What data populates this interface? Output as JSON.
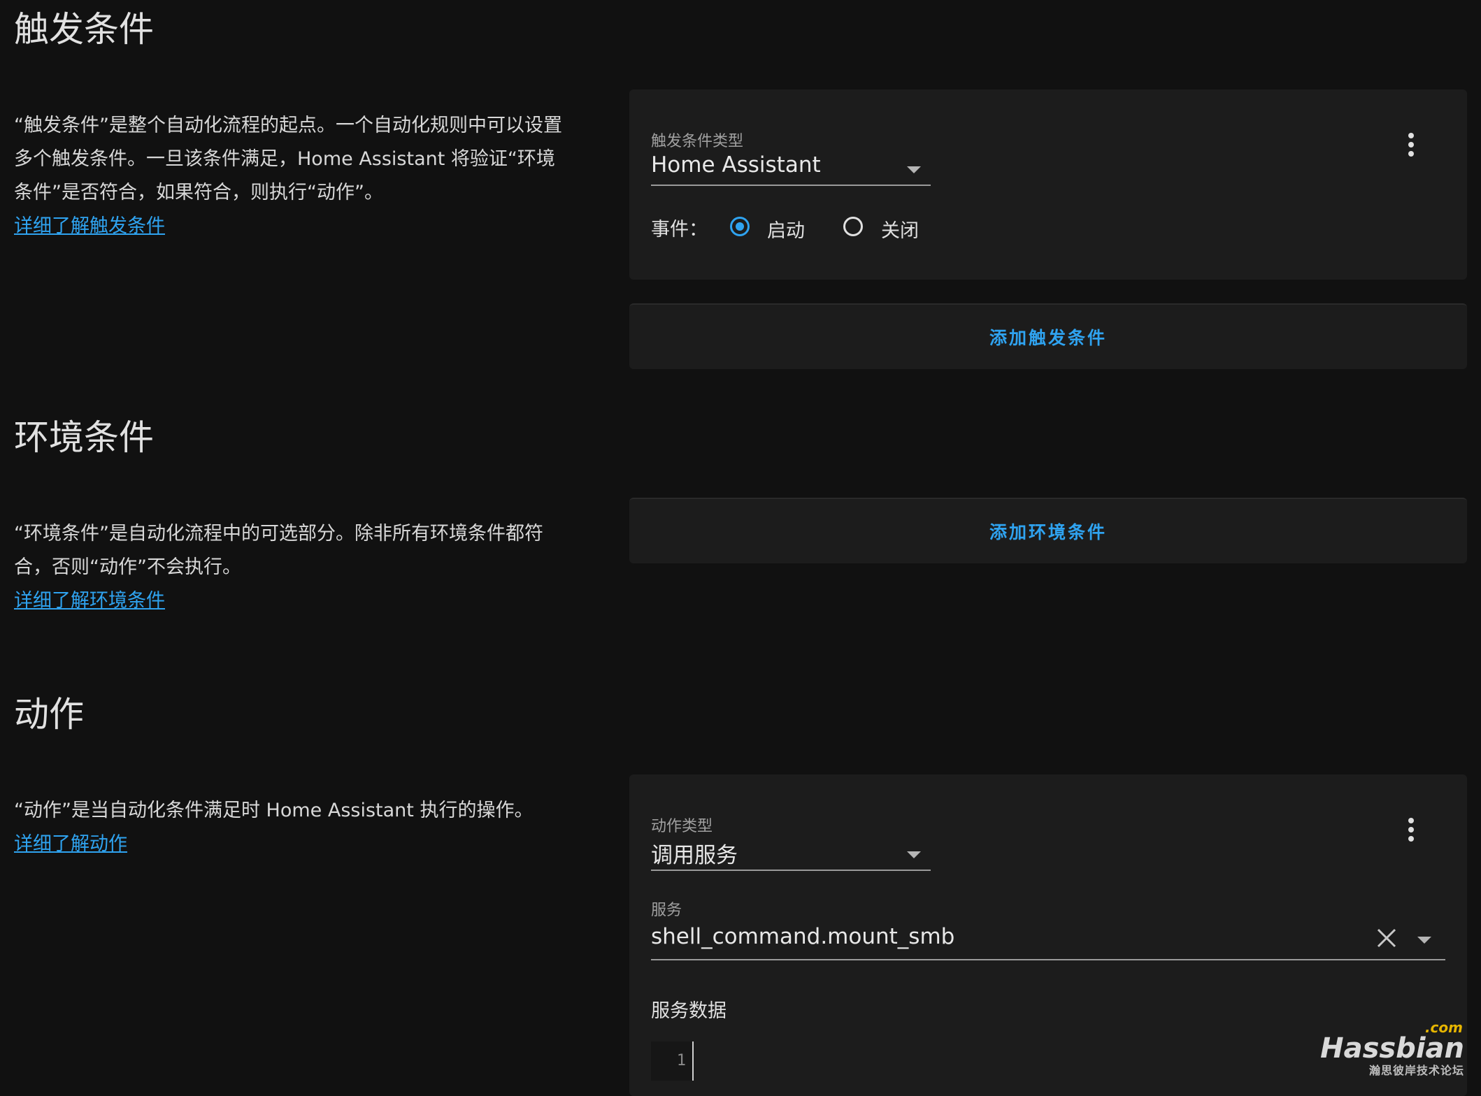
{
  "triggers": {
    "title": "触发条件",
    "description": "“触发条件”是整个自动化流程的起点。一个自动化规则中可以设置多个触发条件。一旦该条件满足，Home Assistant 将验证“环境条件”是否符合，如果符合，则执行“动作”。",
    "learn_more": "详细了解触发条件",
    "card": {
      "type_label": "触发条件类型",
      "type_value": "Home Assistant",
      "event_label": "事件：",
      "options": [
        "启动",
        "关闭"
      ],
      "selected": "启动"
    },
    "add_label": "添加触发条件"
  },
  "conditions": {
    "title": "环境条件",
    "description": "“环境条件”是自动化流程中的可选部分。除非所有环境条件都符合，否则“动作”不会执行。",
    "learn_more": "详细了解环境条件",
    "add_label": "添加环境条件"
  },
  "actions": {
    "title": "动作",
    "description": "“动作”是当自动化条件满足时 Home Assistant 执行的操作。",
    "learn_more": "详细了解动作",
    "card": {
      "type_label": "动作类型",
      "type_value": "调用服务",
      "service_label": "服务",
      "service_value": "shell_command.mount_smb",
      "service_data_label": "服务数据",
      "editor_line_number": "1"
    }
  },
  "icons": [
    "chevron-down-icon",
    "more-vert-icon",
    "close-icon"
  ],
  "colors": {
    "accent": "#2fa3f0",
    "background": "#111111",
    "card": "#1c1c1c"
  },
  "watermark": {
    "com": ".com",
    "brand": "Hassbian",
    "subtitle": "瀚思彼岸技术论坛"
  }
}
